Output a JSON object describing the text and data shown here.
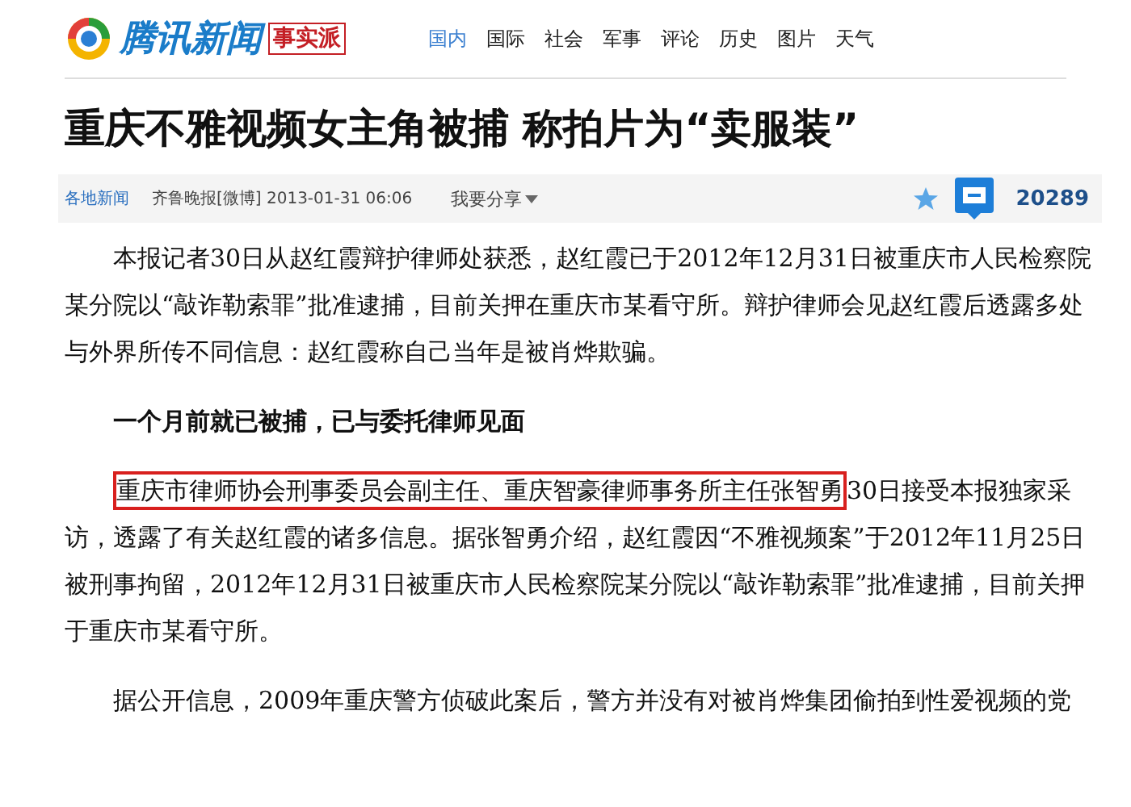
{
  "header": {
    "logo_text": "腾讯新闻",
    "stamp": "事实派",
    "nav": [
      {
        "label": "国内",
        "selected": true
      },
      {
        "label": "国际",
        "selected": false
      },
      {
        "label": "社会",
        "selected": false
      },
      {
        "label": "军事",
        "selected": false
      },
      {
        "label": "评论",
        "selected": false
      },
      {
        "label": "历史",
        "selected": false
      },
      {
        "label": "图片",
        "selected": false
      },
      {
        "label": "天气",
        "selected": false
      }
    ]
  },
  "article": {
    "title": "重庆不雅视频女主角被捕 称拍片为“卖服装”",
    "meta": {
      "channel": "各地新闻",
      "source": "齐鲁晚报[微博] 2013-01-31 06:06",
      "share": "我要分享",
      "comment_count": "20289"
    },
    "body": [
      {
        "kind": "paragraph",
        "text": "本报记者30日从赵红霞辩护律师处获悉，赵红霞已于2012年12月31日被重庆市人民检察院某分院以“敲诈勒索罪”批准逮捕，目前关押在重庆市某看守所。辩护律师会见赵红霞后透露多处与外界所传不同信息：赵红霞称自己当年是被肖烨欺骗。"
      },
      {
        "kind": "heading",
        "text": "一个月前就已被捕，已与委托律师见面"
      },
      {
        "kind": "highlighted",
        "highlight": "重庆市律师协会刑事委员会副主任、重庆智豪律师事务所主任张智勇",
        "text": "30日接受本报独家采访，透露了有关赵红霞的诸多信息。据张智勇介绍，赵红霞因“不雅视频案”于2012年11月25日被刑事拘留，2012年12月31日被重庆市人民检察院某分院以“敲诈勒索罪”批准逮捕，目前关押于重庆市某看守所。"
      },
      {
        "kind": "paragraph",
        "text": "据公开信息，2009年重庆警方侦破此案后，警方并没有对被肖烨集团偷拍到性爱视频的党"
      }
    ]
  }
}
